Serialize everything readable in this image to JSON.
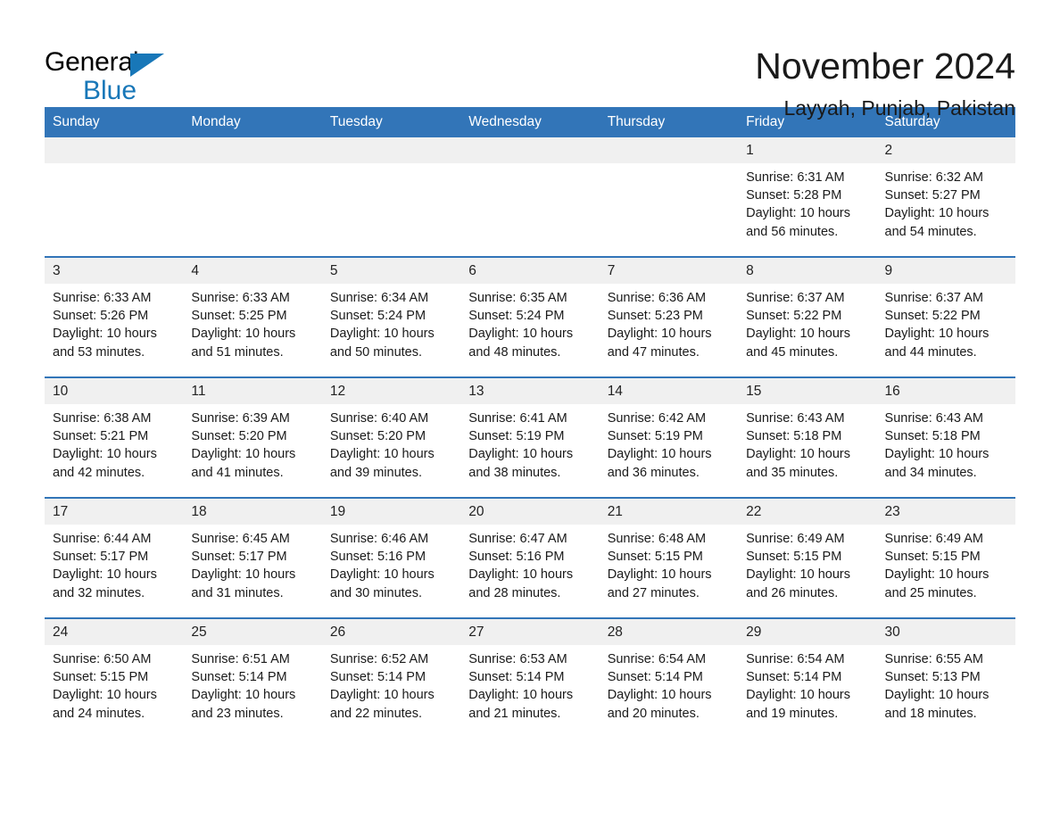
{
  "brand": {
    "name_part1": "General",
    "name_part2": "Blue",
    "triangle_color": "#1877b8"
  },
  "header": {
    "title": "November 2024",
    "subtitle": "Layyah, Punjab, Pakistan"
  },
  "theme": {
    "header_blue": "#3275b8",
    "daynum_gray": "#f0f0f0",
    "text": "#1a1a1a"
  },
  "weekdays": [
    "Sunday",
    "Monday",
    "Tuesday",
    "Wednesday",
    "Thursday",
    "Friday",
    "Saturday"
  ],
  "weeks": [
    [
      {
        "day": "",
        "sunrise": "",
        "sunset": "",
        "daylight": ""
      },
      {
        "day": "",
        "sunrise": "",
        "sunset": "",
        "daylight": ""
      },
      {
        "day": "",
        "sunrise": "",
        "sunset": "",
        "daylight": ""
      },
      {
        "day": "",
        "sunrise": "",
        "sunset": "",
        "daylight": ""
      },
      {
        "day": "",
        "sunrise": "",
        "sunset": "",
        "daylight": ""
      },
      {
        "day": "1",
        "sunrise": "Sunrise: 6:31 AM",
        "sunset": "Sunset: 5:28 PM",
        "daylight": "Daylight: 10 hours and 56 minutes."
      },
      {
        "day": "2",
        "sunrise": "Sunrise: 6:32 AM",
        "sunset": "Sunset: 5:27 PM",
        "daylight": "Daylight: 10 hours and 54 minutes."
      }
    ],
    [
      {
        "day": "3",
        "sunrise": "Sunrise: 6:33 AM",
        "sunset": "Sunset: 5:26 PM",
        "daylight": "Daylight: 10 hours and 53 minutes."
      },
      {
        "day": "4",
        "sunrise": "Sunrise: 6:33 AM",
        "sunset": "Sunset: 5:25 PM",
        "daylight": "Daylight: 10 hours and 51 minutes."
      },
      {
        "day": "5",
        "sunrise": "Sunrise: 6:34 AM",
        "sunset": "Sunset: 5:24 PM",
        "daylight": "Daylight: 10 hours and 50 minutes."
      },
      {
        "day": "6",
        "sunrise": "Sunrise: 6:35 AM",
        "sunset": "Sunset: 5:24 PM",
        "daylight": "Daylight: 10 hours and 48 minutes."
      },
      {
        "day": "7",
        "sunrise": "Sunrise: 6:36 AM",
        "sunset": "Sunset: 5:23 PM",
        "daylight": "Daylight: 10 hours and 47 minutes."
      },
      {
        "day": "8",
        "sunrise": "Sunrise: 6:37 AM",
        "sunset": "Sunset: 5:22 PM",
        "daylight": "Daylight: 10 hours and 45 minutes."
      },
      {
        "day": "9",
        "sunrise": "Sunrise: 6:37 AM",
        "sunset": "Sunset: 5:22 PM",
        "daylight": "Daylight: 10 hours and 44 minutes."
      }
    ],
    [
      {
        "day": "10",
        "sunrise": "Sunrise: 6:38 AM",
        "sunset": "Sunset: 5:21 PM",
        "daylight": "Daylight: 10 hours and 42 minutes."
      },
      {
        "day": "11",
        "sunrise": "Sunrise: 6:39 AM",
        "sunset": "Sunset: 5:20 PM",
        "daylight": "Daylight: 10 hours and 41 minutes."
      },
      {
        "day": "12",
        "sunrise": "Sunrise: 6:40 AM",
        "sunset": "Sunset: 5:20 PM",
        "daylight": "Daylight: 10 hours and 39 minutes."
      },
      {
        "day": "13",
        "sunrise": "Sunrise: 6:41 AM",
        "sunset": "Sunset: 5:19 PM",
        "daylight": "Daylight: 10 hours and 38 minutes."
      },
      {
        "day": "14",
        "sunrise": "Sunrise: 6:42 AM",
        "sunset": "Sunset: 5:19 PM",
        "daylight": "Daylight: 10 hours and 36 minutes."
      },
      {
        "day": "15",
        "sunrise": "Sunrise: 6:43 AM",
        "sunset": "Sunset: 5:18 PM",
        "daylight": "Daylight: 10 hours and 35 minutes."
      },
      {
        "day": "16",
        "sunrise": "Sunrise: 6:43 AM",
        "sunset": "Sunset: 5:18 PM",
        "daylight": "Daylight: 10 hours and 34 minutes."
      }
    ],
    [
      {
        "day": "17",
        "sunrise": "Sunrise: 6:44 AM",
        "sunset": "Sunset: 5:17 PM",
        "daylight": "Daylight: 10 hours and 32 minutes."
      },
      {
        "day": "18",
        "sunrise": "Sunrise: 6:45 AM",
        "sunset": "Sunset: 5:17 PM",
        "daylight": "Daylight: 10 hours and 31 minutes."
      },
      {
        "day": "19",
        "sunrise": "Sunrise: 6:46 AM",
        "sunset": "Sunset: 5:16 PM",
        "daylight": "Daylight: 10 hours and 30 minutes."
      },
      {
        "day": "20",
        "sunrise": "Sunrise: 6:47 AM",
        "sunset": "Sunset: 5:16 PM",
        "daylight": "Daylight: 10 hours and 28 minutes."
      },
      {
        "day": "21",
        "sunrise": "Sunrise: 6:48 AM",
        "sunset": "Sunset: 5:15 PM",
        "daylight": "Daylight: 10 hours and 27 minutes."
      },
      {
        "day": "22",
        "sunrise": "Sunrise: 6:49 AM",
        "sunset": "Sunset: 5:15 PM",
        "daylight": "Daylight: 10 hours and 26 minutes."
      },
      {
        "day": "23",
        "sunrise": "Sunrise: 6:49 AM",
        "sunset": "Sunset: 5:15 PM",
        "daylight": "Daylight: 10 hours and 25 minutes."
      }
    ],
    [
      {
        "day": "24",
        "sunrise": "Sunrise: 6:50 AM",
        "sunset": "Sunset: 5:15 PM",
        "daylight": "Daylight: 10 hours and 24 minutes."
      },
      {
        "day": "25",
        "sunrise": "Sunrise: 6:51 AM",
        "sunset": "Sunset: 5:14 PM",
        "daylight": "Daylight: 10 hours and 23 minutes."
      },
      {
        "day": "26",
        "sunrise": "Sunrise: 6:52 AM",
        "sunset": "Sunset: 5:14 PM",
        "daylight": "Daylight: 10 hours and 22 minutes."
      },
      {
        "day": "27",
        "sunrise": "Sunrise: 6:53 AM",
        "sunset": "Sunset: 5:14 PM",
        "daylight": "Daylight: 10 hours and 21 minutes."
      },
      {
        "day": "28",
        "sunrise": "Sunrise: 6:54 AM",
        "sunset": "Sunset: 5:14 PM",
        "daylight": "Daylight: 10 hours and 20 minutes."
      },
      {
        "day": "29",
        "sunrise": "Sunrise: 6:54 AM",
        "sunset": "Sunset: 5:14 PM",
        "daylight": "Daylight: 10 hours and 19 minutes."
      },
      {
        "day": "30",
        "sunrise": "Sunrise: 6:55 AM",
        "sunset": "Sunset: 5:13 PM",
        "daylight": "Daylight: 10 hours and 18 minutes."
      }
    ]
  ]
}
